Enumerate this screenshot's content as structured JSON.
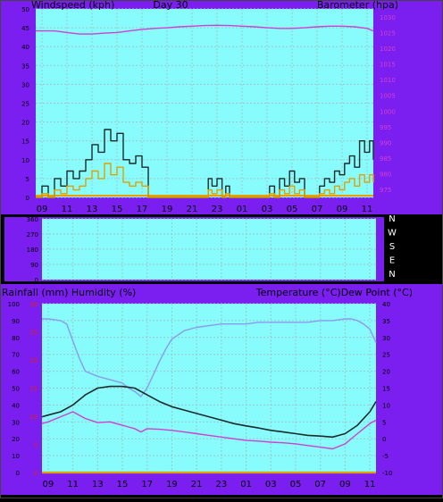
{
  "colors": {
    "frame": "#7b1ff0",
    "plot_bg": "#88fcfc",
    "grid": "#9cc7c7",
    "wind_avg": "#e0a000",
    "wind_gust": "#1c2a2a",
    "barometer": "#d040d0",
    "temperature": "#1c2a2a",
    "dewpoint": "#d040d0",
    "humidity": "#8a9af0",
    "rainfall": "#e0a000",
    "baseline": "#e8a000",
    "left_axis_text": "#000000",
    "right_axis_text": "#d040d0",
    "rain_axis_text": "#e02020"
  },
  "icons": {
    "degree": "°"
  },
  "chart_data": [
    {
      "type": "line",
      "panel": "wind-barometer",
      "header_left": "Windspeed (kph)",
      "header_center": "Day 30",
      "header_right": "Barometer (hpa)",
      "x_ticks": [
        "09",
        "11",
        "13",
        "15",
        "17",
        "19",
        "21",
        "23",
        "01",
        "03",
        "05",
        "07",
        "09",
        "11"
      ],
      "left_axis": {
        "ticks": [
          "0",
          "5",
          "10",
          "15",
          "20",
          "25",
          "30",
          "35",
          "40",
          "45",
          "50"
        ],
        "range": [
          0,
          50
        ]
      },
      "right_axis": {
        "ticks": [
          "975",
          "980",
          "985",
          "990",
          "995",
          "1000",
          "1005",
          "1010",
          "1015",
          "1020",
          "1025",
          "1030"
        ],
        "range": [
          972.5,
          1032.5
        ]
      },
      "series": [
        {
          "key": "barometer",
          "axis": "right",
          "x": [
            8.5,
            10,
            11,
            12,
            13,
            14,
            15,
            16,
            17,
            18,
            19,
            20,
            21,
            22,
            23,
            24,
            25,
            26,
            27,
            28,
            29,
            30,
            31,
            32,
            33,
            34,
            35,
            35.5
          ],
          "values": [
            1025.5,
            1025.5,
            1025,
            1024.5,
            1024.5,
            1024.8,
            1025,
            1025.5,
            1026,
            1026.3,
            1026.5,
            1026.8,
            1027,
            1027.2,
            1027.3,
            1027.2,
            1027,
            1026.8,
            1026.5,
            1026.3,
            1026.3,
            1026.5,
            1026.8,
            1027,
            1027,
            1026.8,
            1026.3,
            1025.5
          ]
        },
        {
          "key": "wind_gust",
          "axis": "left",
          "x": [
            8.5,
            9,
            9.5,
            10,
            10.5,
            11,
            11.5,
            12,
            12.5,
            13,
            13.5,
            14,
            14.5,
            15,
            15.5,
            16,
            16.5,
            17,
            17.5,
            18,
            19,
            20,
            21,
            22,
            22.3,
            22.6,
            23,
            23.4,
            23.7,
            24,
            25,
            26,
            26.8,
            27.2,
            27.6,
            28,
            28.4,
            28.8,
            29.2,
            29.6,
            30,
            30.5,
            31,
            31.2,
            31.6,
            32,
            32.4,
            32.8,
            33.2,
            33.6,
            34,
            34.4,
            34.8,
            35.2,
            35.5
          ],
          "values": [
            0,
            3,
            0,
            5,
            3,
            7,
            5,
            7,
            10,
            14,
            12,
            18,
            15,
            17,
            10,
            9,
            11,
            8,
            0,
            0,
            0,
            0,
            0,
            0,
            5,
            3,
            5,
            0,
            3,
            0,
            0,
            0,
            0,
            3,
            0,
            5,
            3,
            7,
            4,
            5,
            0,
            0,
            0,
            3,
            5,
            4,
            7,
            6,
            9,
            11,
            8,
            15,
            12,
            15,
            10
          ]
        },
        {
          "key": "wind_avg",
          "axis": "left",
          "x": [
            8.5,
            9,
            9.5,
            10,
            10.5,
            11,
            11.5,
            12,
            12.5,
            13,
            13.5,
            14,
            14.5,
            15,
            15.5,
            16,
            16.5,
            17,
            17.5,
            18,
            19,
            20,
            21,
            22,
            22.3,
            22.6,
            23,
            23.4,
            23.7,
            24,
            25,
            26,
            26.8,
            27.2,
            27.6,
            28,
            28.4,
            28.8,
            29.2,
            29.6,
            30,
            30.5,
            31,
            31.2,
            31.6,
            32,
            32.4,
            32.8,
            33.2,
            33.6,
            34,
            34.4,
            34.8,
            35.2,
            35.5
          ],
          "values": [
            0,
            1,
            0,
            2,
            1,
            3,
            2,
            3,
            5,
            7,
            5,
            9,
            6,
            8,
            4,
            3,
            4,
            3,
            0,
            0,
            0,
            0,
            0,
            0,
            2,
            1,
            2,
            0,
            1,
            0,
            0,
            0,
            0,
            1,
            0,
            2,
            1,
            3,
            1,
            2,
            0,
            0,
            0,
            1,
            2,
            1,
            3,
            2,
            4,
            5,
            3,
            6,
            4,
            6,
            4
          ]
        }
      ]
    },
    {
      "type": "line",
      "panel": "wind-direction",
      "left_axis": {
        "ticks": [
          "0",
          "90",
          "180",
          "270",
          "360"
        ],
        "range": [
          0,
          360
        ]
      },
      "right_labels": [
        "N",
        "W",
        "S",
        "E",
        "N"
      ],
      "series": []
    },
    {
      "type": "line",
      "panel": "temperature-humidity",
      "header_left": "Rainfall (mm)  Humidity (%)",
      "header_right": "Temperature (°C)Dew Point (°C)",
      "x_ticks": [
        "09",
        "11",
        "13",
        "15",
        "17",
        "19",
        "21",
        "23",
        "01",
        "03",
        "05",
        "07",
        "09",
        "11"
      ],
      "humidity_axis": {
        "ticks": [
          "0",
          "10",
          "20",
          "30",
          "40",
          "50",
          "60",
          "70",
          "80",
          "90",
          "100"
        ],
        "range": [
          0,
          100
        ]
      },
      "rain_axis": {
        "ticks": [
          "0",
          "5",
          "10",
          "15",
          "20",
          "25",
          "30"
        ],
        "range": [
          0,
          30
        ]
      },
      "right_axis": {
        "ticks": [
          "-10",
          "-5",
          "0",
          "5",
          "10",
          "15",
          "20",
          "25",
          "30",
          "35",
          "40"
        ],
        "range": [
          -10,
          40
        ]
      },
      "series": [
        {
          "key": "humidity",
          "axis": "humidity",
          "x": [
            8.5,
            9,
            10,
            10.5,
            11,
            11.5,
            12,
            13,
            14,
            15,
            15.5,
            16,
            16.5,
            17,
            17.5,
            18,
            18.5,
            19,
            20,
            21,
            22,
            23,
            24,
            25,
            26,
            27,
            28,
            29,
            30,
            31,
            32,
            33,
            33.5,
            34,
            34.5,
            35,
            35.5
          ],
          "values": [
            91,
            91,
            90,
            88,
            78,
            68,
            60,
            57,
            55,
            53,
            50,
            48,
            45,
            50,
            58,
            66,
            73,
            79,
            84,
            86,
            87,
            88,
            88,
            88,
            89,
            89,
            89,
            89,
            89,
            90,
            90,
            91,
            91,
            90,
            88,
            85,
            77
          ]
        },
        {
          "key": "temperature",
          "axis": "right",
          "x": [
            8.5,
            9,
            10,
            11,
            12,
            13,
            14,
            15,
            16,
            17,
            18,
            19,
            20,
            21,
            22,
            23,
            24,
            25,
            26,
            27,
            28,
            29,
            30,
            31,
            32,
            33,
            34,
            35,
            35.5
          ],
          "values": [
            6.5,
            7,
            8,
            10,
            13,
            15,
            15.5,
            15.5,
            15,
            13,
            11,
            9.5,
            8.5,
            7.5,
            6.5,
            5.5,
            4.5,
            3.8,
            3.2,
            2.5,
            2,
            1.5,
            1,
            0.8,
            0.5,
            1.5,
            4,
            8,
            11
          ]
        },
        {
          "key": "dewpoint",
          "axis": "right",
          "x": [
            8.5,
            9,
            10,
            11,
            12,
            13,
            14,
            15,
            15.5,
            16,
            16.5,
            17,
            18,
            19,
            20,
            21,
            22,
            23,
            24,
            25,
            26,
            27,
            28,
            29,
            30,
            31,
            32,
            33,
            34,
            35,
            35.5
          ],
          "values": [
            4.5,
            5,
            6.5,
            8,
            6,
            4.8,
            5,
            4,
            3.5,
            3,
            2,
            3,
            2.8,
            2.5,
            2,
            1.5,
            1,
            0.5,
            0,
            -0.5,
            -0.7,
            -1,
            -1.2,
            -1.5,
            -2,
            -2.5,
            -3,
            -1.5,
            1.5,
            4.5,
            5.5
          ]
        },
        {
          "key": "rainfall",
          "axis": "rain",
          "x": [
            8.5,
            35.5
          ],
          "values": [
            0,
            0
          ]
        }
      ]
    }
  ]
}
